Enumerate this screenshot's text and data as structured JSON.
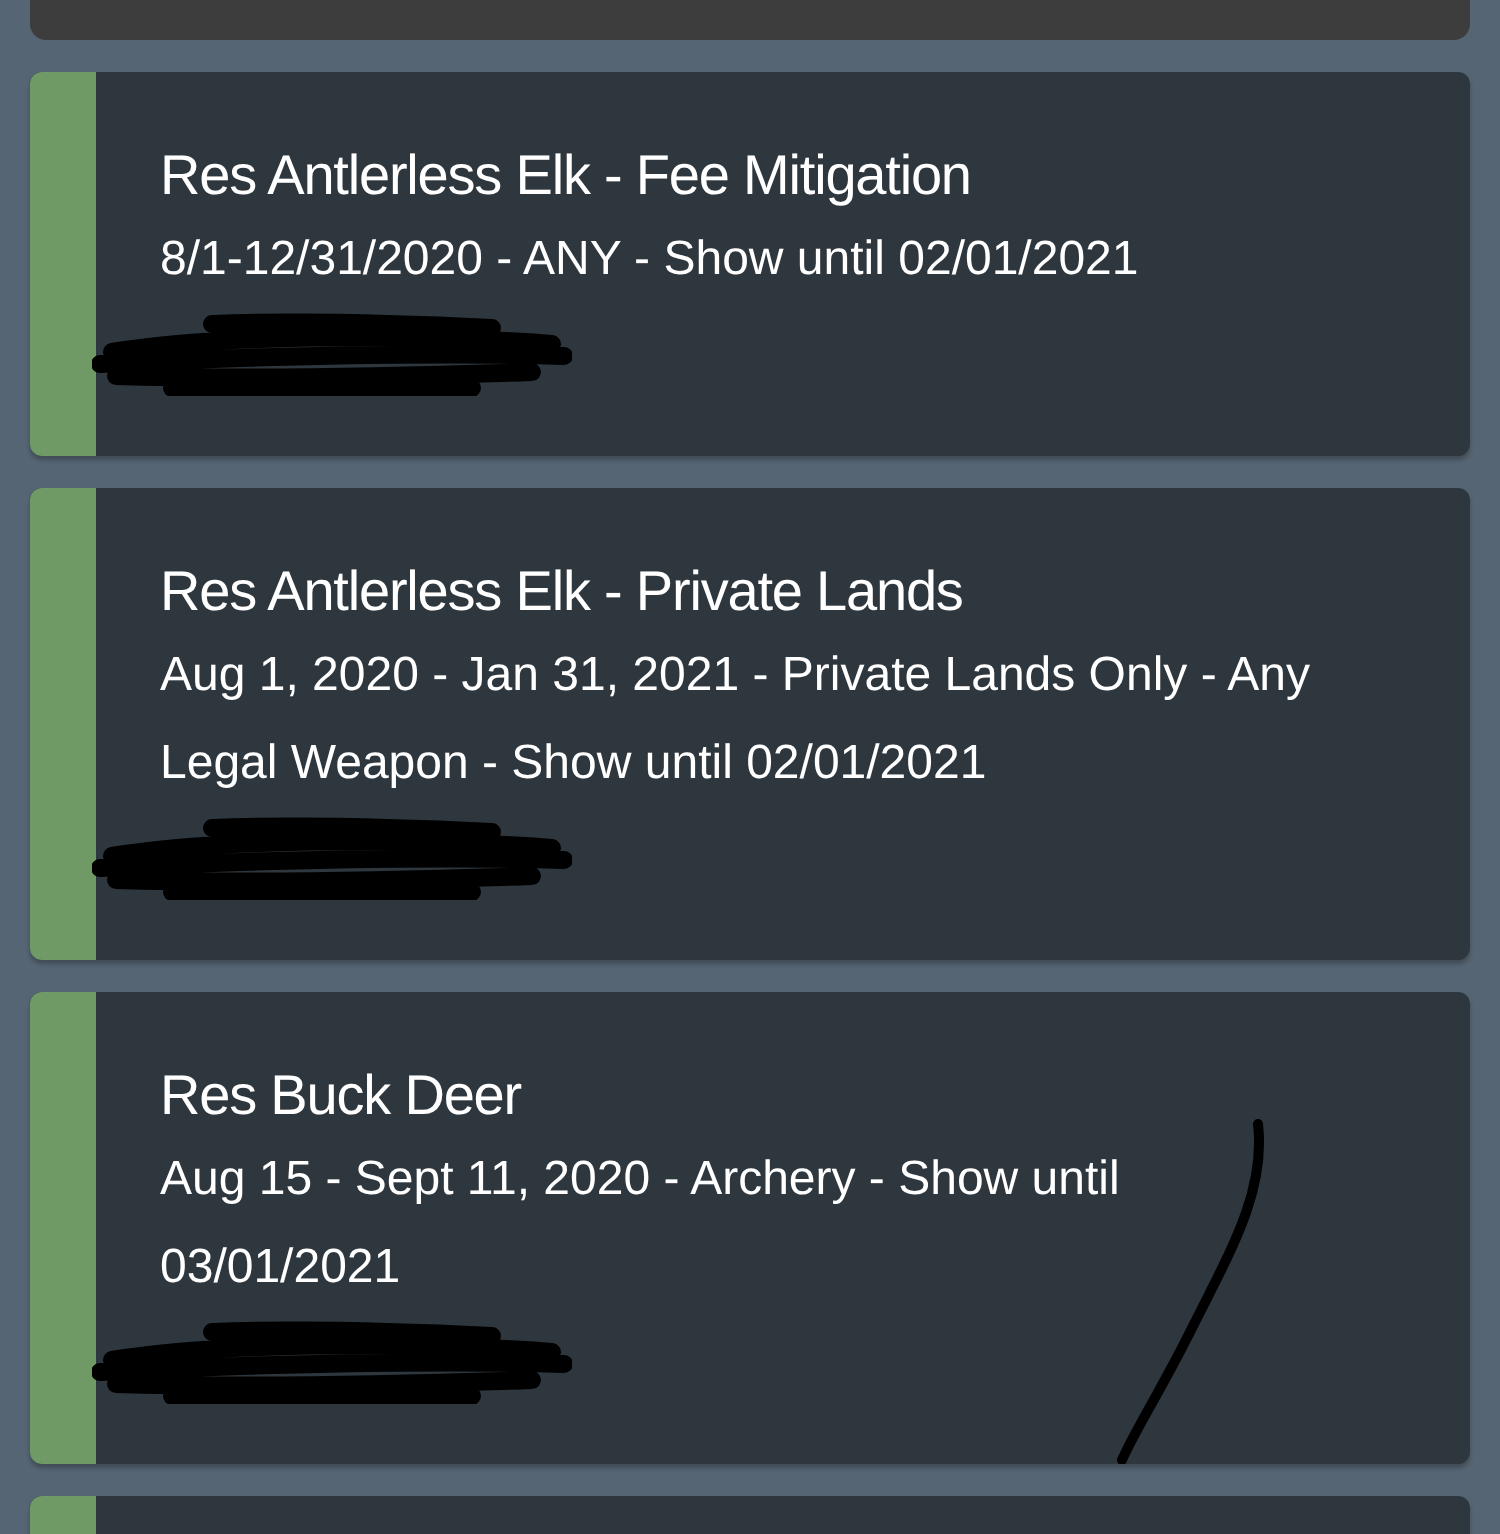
{
  "cards": [
    {
      "title": "Res Antlerless Elk - Fee Mitigation",
      "detail": "8/1-12/31/2020 - ANY - Show until 02/01/2021",
      "pen_mark": false
    },
    {
      "title": "Res Antlerless Elk - Private Lands",
      "detail": "Aug 1, 2020 - Jan 31, 2021 - Private Lands Only - Any Legal Weapon - Show until 02/01/2021",
      "pen_mark": false
    },
    {
      "title": "Res Buck Deer",
      "detail": "Aug 15 - Sept 11, 2020 - Archery - Show until 03/01/2021",
      "pen_mark": true
    }
  ]
}
